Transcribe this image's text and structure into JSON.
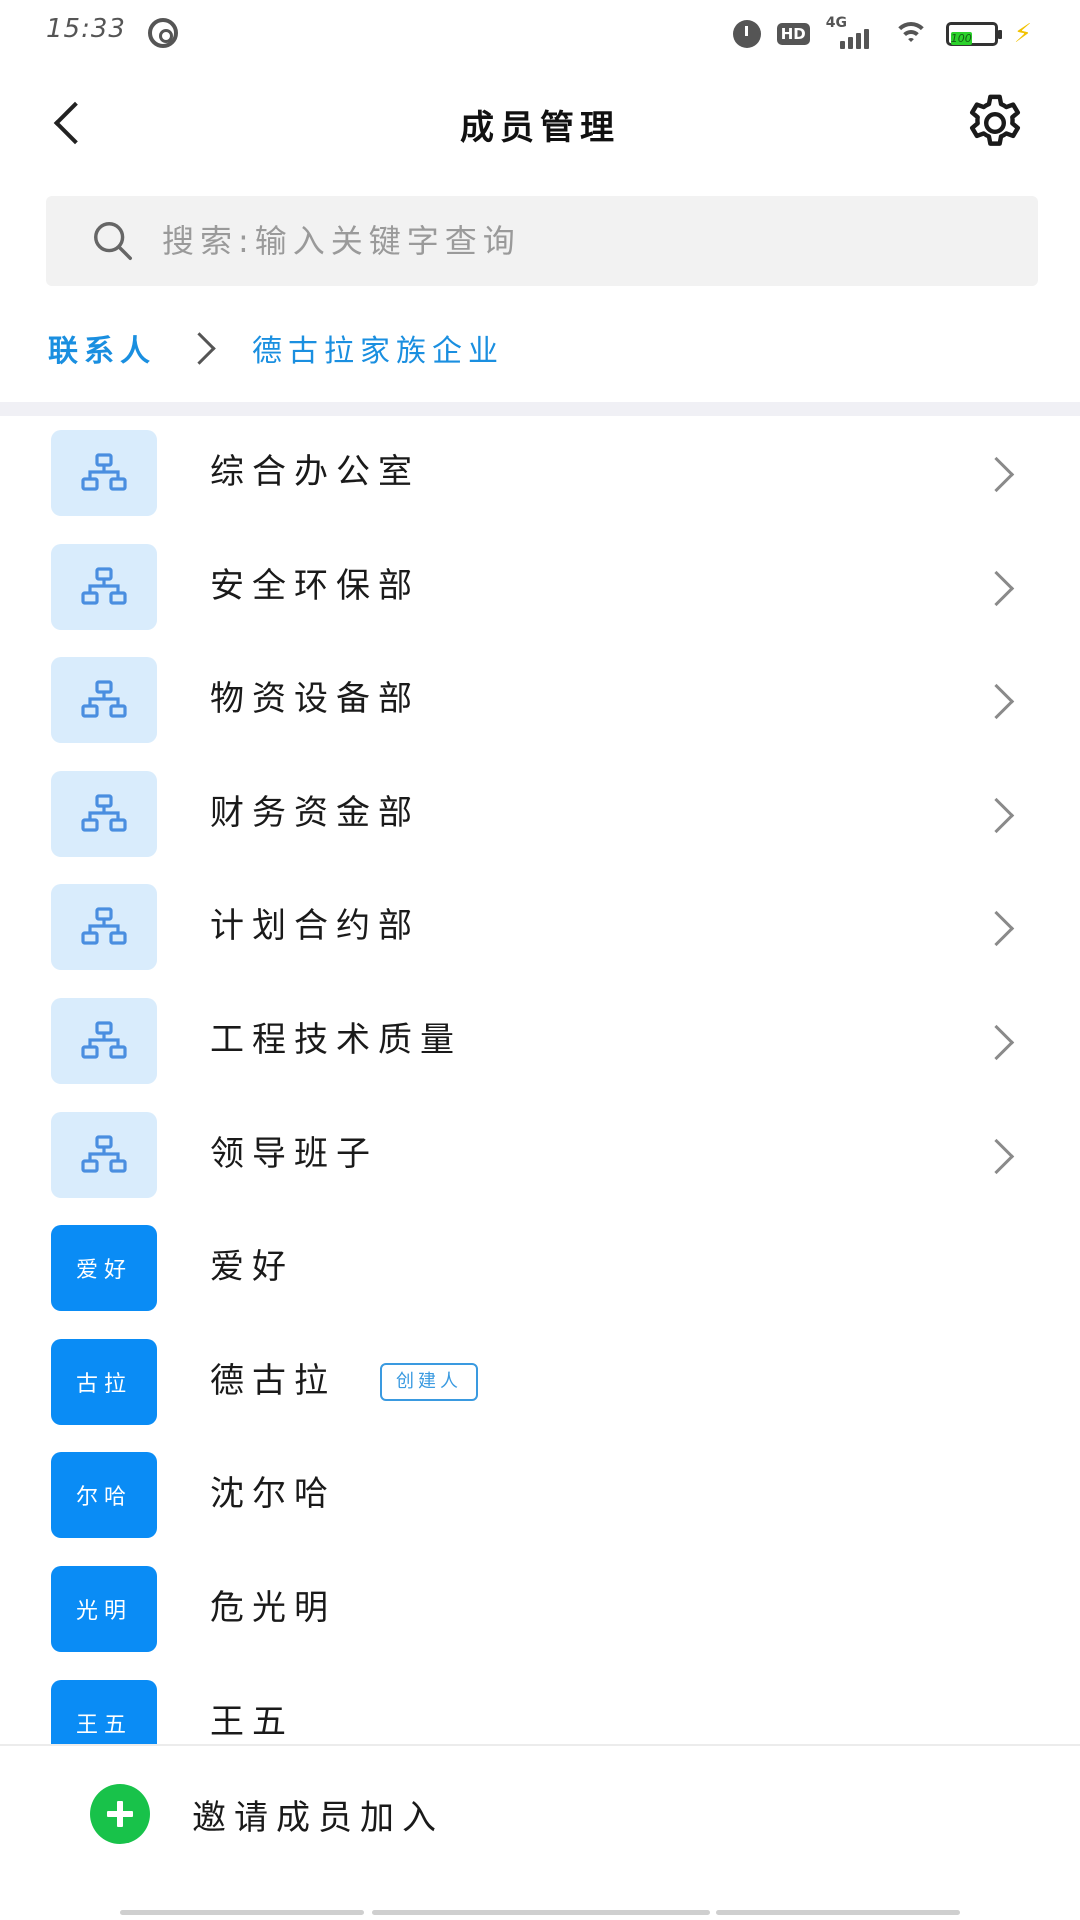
{
  "status_bar": {
    "time": "15:33",
    "network": "4G",
    "hd": "HD",
    "battery": "100"
  },
  "header": {
    "title": "成员管理"
  },
  "search": {
    "placeholder": "搜索:输入关键字查询",
    "value": ""
  },
  "breadcrumb": {
    "root": "联系人",
    "current": "德古拉家族企业"
  },
  "departments": [
    {
      "label": "综合办公室"
    },
    {
      "label": "安全环保部"
    },
    {
      "label": "物资设备部"
    },
    {
      "label": "财务资金部"
    },
    {
      "label": "计划合约部"
    },
    {
      "label": "工程技术质量"
    },
    {
      "label": "领导班子"
    }
  ],
  "members": [
    {
      "avatar_text": "爱好",
      "name": "爱好",
      "badge": ""
    },
    {
      "avatar_text": "古拉",
      "name": "德古拉",
      "badge": "创建人"
    },
    {
      "avatar_text": "尔哈",
      "name": "沈尔哈",
      "badge": ""
    },
    {
      "avatar_text": "光明",
      "name": "危光明",
      "badge": ""
    },
    {
      "avatar_text": "王五",
      "name": "王五",
      "badge": ""
    }
  ],
  "bottom": {
    "invite_label": "邀请成员加入"
  },
  "colors": {
    "accent": "#1a8fe0",
    "member_avatar": "#0a8cf5",
    "dept_avatar_bg": "#d9ecfc",
    "invite_plus": "#18c24a",
    "battery": "#2bd12b"
  },
  "icons": {
    "back": "chevron-left-icon",
    "settings": "gear-icon",
    "search": "search-icon",
    "department": "org-chart-icon",
    "row_arrow": "chevron-right-icon",
    "invite": "plus-circle-icon"
  }
}
